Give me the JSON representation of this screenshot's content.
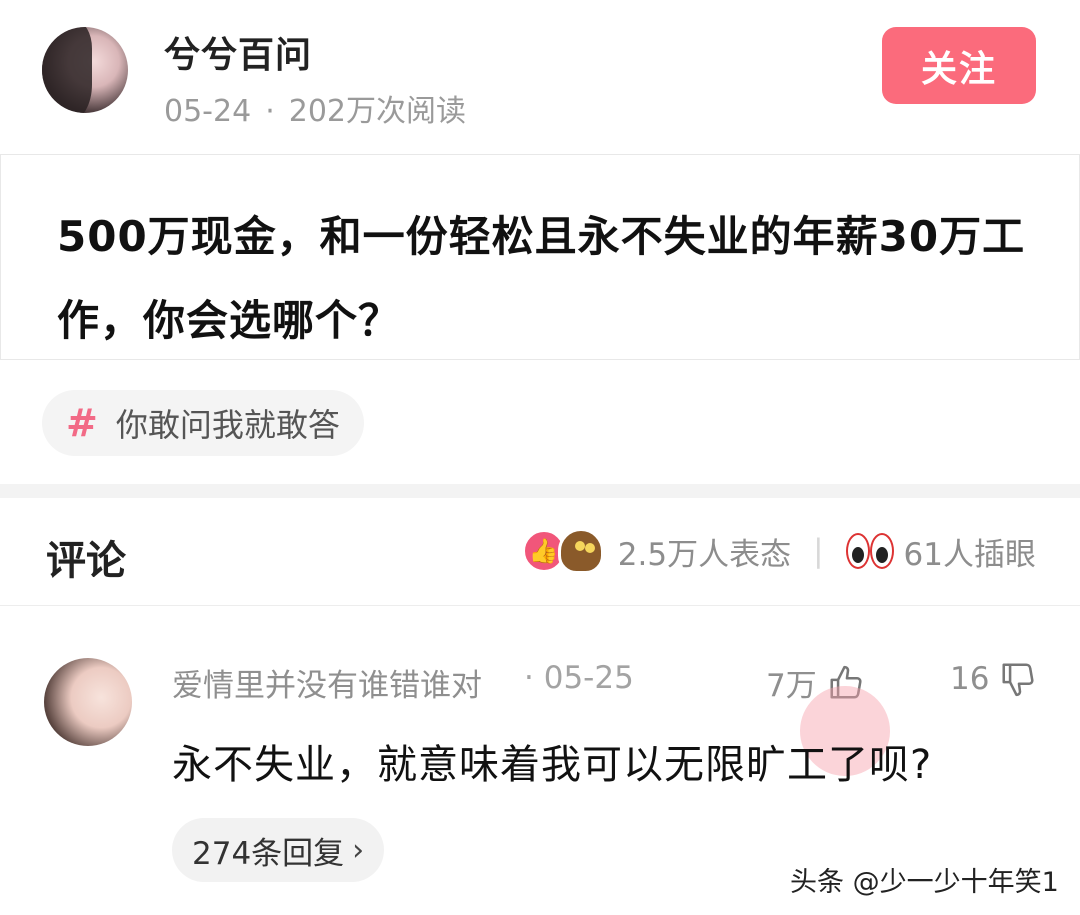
{
  "post": {
    "author": "兮兮百问",
    "date": "05-24",
    "reads": "202万次阅读",
    "follow_label": "关注"
  },
  "question": {
    "title": "500万现金，和一份轻松且永不失业的年薪30万工作，你会选哪个？"
  },
  "topic": {
    "label": "你敢问我就敢答"
  },
  "comments_section": {
    "title": "评论",
    "reaction_count": "2.5万人表态",
    "eye_count": "61人插眼"
  },
  "comment": {
    "user": "爱情里并没有谁错谁对",
    "date": "05-25",
    "likes": "7万",
    "dislikes": "16",
    "text": "永不失业，就意味着我可以无限旷工了呗?",
    "replies_label": "274条回复"
  },
  "watermark": "头条 @少一少十年笑1",
  "colors": {
    "accent": "#fb6b7c",
    "tag_hash": "#f26a86"
  }
}
